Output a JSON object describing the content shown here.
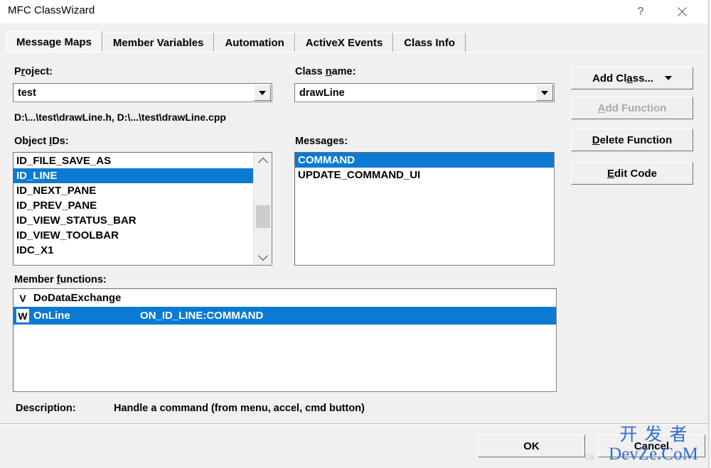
{
  "window": {
    "title": "MFC ClassWizard",
    "help_icon": "?",
    "close_icon": "x"
  },
  "tabs": [
    {
      "label": "Message Maps",
      "active": true
    },
    {
      "label": "Member Variables",
      "active": false
    },
    {
      "label": "Automation",
      "active": false
    },
    {
      "label": "ActiveX Events",
      "active": false
    },
    {
      "label": "Class Info",
      "active": false
    }
  ],
  "project": {
    "label_pre": "P",
    "label_accel": "r",
    "label_post": "oject:",
    "value": "test"
  },
  "class_name": {
    "label_pre": "Class ",
    "label_accel": "n",
    "label_post": "ame:",
    "value": "drawLine"
  },
  "file_paths": "D:\\...\\test\\drawLine.h, D:\\...\\test\\drawLine.cpp",
  "object_ids": {
    "label_pre": "Object ",
    "label_accel": "I",
    "label_post": "Ds:",
    "items": [
      {
        "text": "ID_FILE_SAVE_AS",
        "selected": false
      },
      {
        "text": "ID_LINE",
        "selected": true
      },
      {
        "text": "ID_NEXT_PANE",
        "selected": false
      },
      {
        "text": "ID_PREV_PANE",
        "selected": false
      },
      {
        "text": "ID_VIEW_STATUS_BAR",
        "selected": false
      },
      {
        "text": "ID_VIEW_TOOLBAR",
        "selected": false
      },
      {
        "text": "IDC_X1",
        "selected": false
      }
    ]
  },
  "messages": {
    "label": "Messages:",
    "items": [
      {
        "text": "COMMAND",
        "selected": true
      },
      {
        "text": "UPDATE_COMMAND_UI",
        "selected": false
      }
    ]
  },
  "member_functions": {
    "label_pre": "Member ",
    "label_accel": "f",
    "label_post": "unctions:",
    "rows": [
      {
        "icon": "V",
        "name": "DoDataExchange",
        "message": "",
        "selected": false
      },
      {
        "icon": "W",
        "name": "OnLine",
        "message": "ON_ID_LINE:COMMAND",
        "selected": true
      }
    ]
  },
  "description": {
    "label": "Description:",
    "value": "Handle a command (from menu, accel, cmd button)"
  },
  "buttons": {
    "add_class": {
      "pre": "Add Cl",
      "accel": "a",
      "post": "ss...",
      "enabled": true,
      "has_dropdown": true
    },
    "add_function": {
      "pre": "",
      "accel": "A",
      "post": "dd Function",
      "enabled": false
    },
    "delete_function": {
      "pre": "",
      "accel": "D",
      "post": "elete Function",
      "enabled": true
    },
    "edit_code": {
      "pre": "",
      "accel": "E",
      "post": "dit Code",
      "enabled": true
    },
    "ok": "OK",
    "cancel": "Cancel"
  },
  "watermark": {
    "chinese": "开发者",
    "latin": "DevZe.CoM",
    "faint": "cs",
    "color": "#2f6fd0"
  },
  "colors": {
    "selection_blue": "#0a7ad2",
    "dialog_face": "#f0f0f0",
    "field_white": "#ffffff",
    "disabled_text": "#aaaaaa"
  }
}
